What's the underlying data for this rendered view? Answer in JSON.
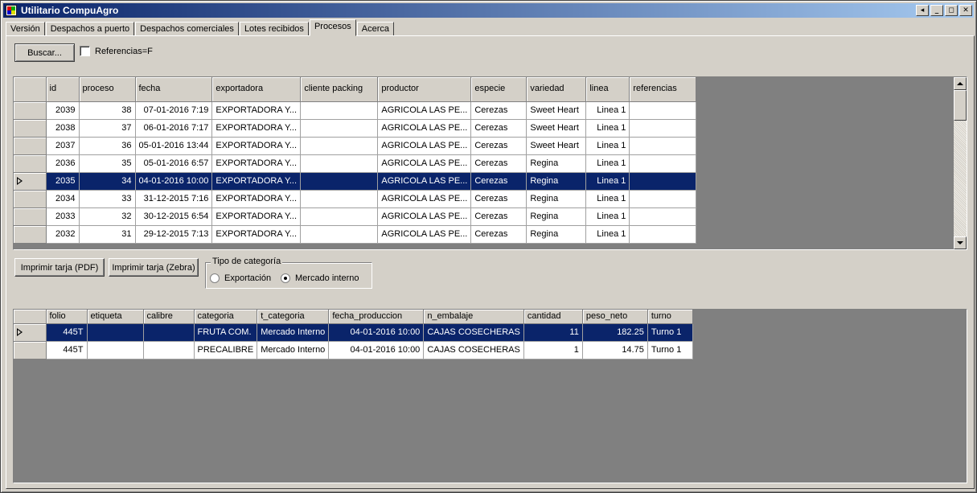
{
  "window": {
    "title": "Utilitario CompuAgro",
    "buttons": {
      "minimize": "_",
      "restore": "◻",
      "close": "✕",
      "help": "◂"
    }
  },
  "tabs": [
    "Versión",
    "Despachos a puerto",
    "Despachos comerciales",
    "Lotes recibidos",
    "Procesos",
    "Acerca"
  ],
  "active_tab": "Procesos",
  "toolbar": {
    "search_label": "Buscar...",
    "refs_checkbox_label": "Referencias=F",
    "refs_checked": false
  },
  "procesos_grid": {
    "columns": [
      "id",
      "proceso",
      "fecha",
      "exportadora",
      "cliente packing",
      "productor",
      "especie",
      "variedad",
      "linea",
      "referencias"
    ],
    "rows": [
      [
        "2039",
        "38",
        "07-01-2016 7:19",
        "EXPORTADORA Y...",
        "",
        "AGRICOLA LAS PE...",
        "Cerezas",
        "Sweet Heart",
        "Linea 1",
        ""
      ],
      [
        "2038",
        "37",
        "06-01-2016 7:17",
        "EXPORTADORA Y...",
        "",
        "AGRICOLA LAS PE...",
        "Cerezas",
        "Sweet Heart",
        "Linea 1",
        ""
      ],
      [
        "2037",
        "36",
        "05-01-2016 13:44",
        "EXPORTADORA Y...",
        "",
        "AGRICOLA LAS PE...",
        "Cerezas",
        "Sweet Heart",
        "Linea 1",
        ""
      ],
      [
        "2036",
        "35",
        "05-01-2016 6:57",
        "EXPORTADORA Y...",
        "",
        "AGRICOLA LAS PE...",
        "Cerezas",
        "Regina",
        "Linea 1",
        ""
      ],
      [
        "2035",
        "34",
        "04-01-2016 10:00",
        "EXPORTADORA Y...",
        "",
        "AGRICOLA LAS PE...",
        "Cerezas",
        "Regina",
        "Linea 1",
        ""
      ],
      [
        "2034",
        "33",
        "31-12-2015 7:16",
        "EXPORTADORA Y...",
        "",
        "AGRICOLA LAS PE...",
        "Cerezas",
        "Regina",
        "Linea 1",
        ""
      ],
      [
        "2033",
        "32",
        "30-12-2015 6:54",
        "EXPORTADORA Y...",
        "",
        "AGRICOLA LAS PE...",
        "Cerezas",
        "Regina",
        "Linea 1",
        ""
      ],
      [
        "2032",
        "31",
        "29-12-2015 7:13",
        "EXPORTADORA Y...",
        "",
        "AGRICOLA LAS PE...",
        "Cerezas",
        "Regina",
        "Linea 1",
        ""
      ]
    ],
    "selected_index": 4
  },
  "print": {
    "pdf_label": "Imprimir tarja (PDF)",
    "zebra_label": "Imprimir tarja (Zebra)"
  },
  "category": {
    "legend": "Tipo de categoría",
    "options": [
      "Exportación",
      "Mercado interno"
    ],
    "selected": "Mercado interno"
  },
  "detalle_grid": {
    "columns": [
      "folio",
      "etiqueta",
      "calibre",
      "categoria",
      "t_categoria",
      "fecha_produccion",
      "n_embalaje",
      "cantidad",
      "peso_neto",
      "turno"
    ],
    "rows": [
      [
        "445T",
        "",
        "",
        "FRUTA COM.",
        "Mercado Interno",
        "04-01-2016 10:00",
        "CAJAS COSECHERAS",
        "11",
        "182.25",
        "Turno 1"
      ],
      [
        "445T",
        "",
        "",
        "PRECALIBRE",
        "Mercado Interno",
        "04-01-2016 10:00",
        "CAJAS COSECHERAS",
        "1",
        "14.75",
        "Turno 1"
      ]
    ],
    "selected_index": 0
  },
  "colors": {
    "selection": "#0a246a",
    "face": "#d4d0c8",
    "grid_bg": "#808080"
  }
}
